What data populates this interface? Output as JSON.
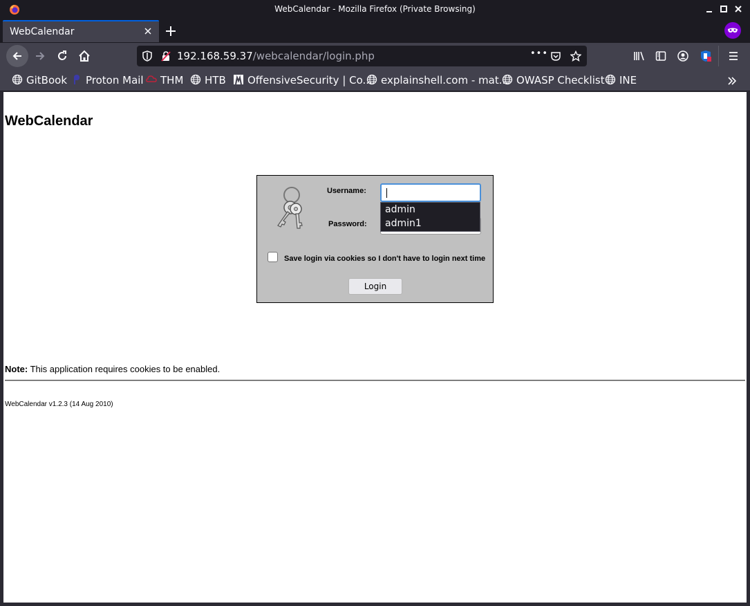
{
  "window": {
    "title": "WebCalendar - Mozilla Firefox (Private Browsing)"
  },
  "tab": {
    "label": "WebCalendar"
  },
  "navbar": {
    "url_host": "192.168.59.37",
    "url_path": "/webcalendar/login.php",
    "more_label": "•••"
  },
  "bookmarks": [
    {
      "label": "GitBook",
      "icon": "globe-icon"
    },
    {
      "label": "Proton Mail",
      "icon": "proton-icon"
    },
    {
      "label": "THM",
      "icon": "thm-icon"
    },
    {
      "label": "HTB",
      "icon": "globe-icon"
    },
    {
      "label": "OffensiveSecurity | Co...",
      "icon": "offsec-icon"
    },
    {
      "label": "explainshell.com - mat...",
      "icon": "globe-icon"
    },
    {
      "label": "OWASP Checklist",
      "icon": "globe-icon"
    },
    {
      "label": "INE",
      "icon": "globe-icon"
    }
  ],
  "page": {
    "heading": "WebCalendar",
    "username_label": "Username:",
    "password_label": "Password:",
    "username_value": "",
    "autocomplete": [
      "admin",
      "admin1"
    ],
    "remember_label": "Save login via cookies so I don't have to login next time",
    "login_button": "Login",
    "note_label": "Note:",
    "note_text": " This application requires cookies to be enabled.",
    "footer": "WebCalendar v1.2.3 (14 Aug 2010)"
  },
  "colors": {
    "chrome_dark": "#1c1b22",
    "chrome_mid": "#42414d",
    "login_panel": "#c0c0c0",
    "accent": "#0060df",
    "private_badge": "#8000d7"
  }
}
